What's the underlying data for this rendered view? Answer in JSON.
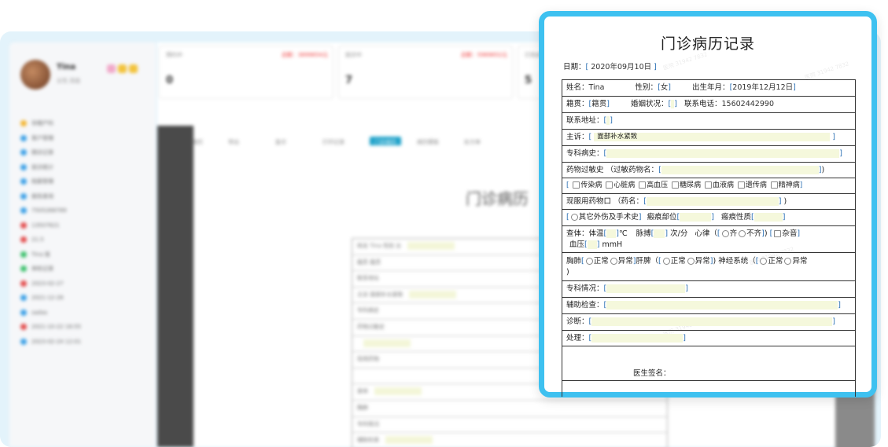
{
  "background": {
    "user": {
      "name": "Tina",
      "sub": "女性 高级"
    },
    "sidebar_items": [
      "孕期产科",
      "客户管理",
      "随访记录",
      "就诊统计",
      "档案管理",
      "报告查询",
      "7505268789",
      "13507621",
      "21.5",
      "Tina 医",
      "体检记录",
      "2023-02-27",
      "2021-12-26",
      "sadas",
      "2021-10-22 16:55",
      "2023-02-24 12:01"
    ],
    "cards": [
      {
        "title": "预约中",
        "alert": "总额：3899654元",
        "value": "0"
      },
      {
        "title": "就诊中",
        "alert": "总额：5969652元",
        "value": "7"
      },
      {
        "title": "已完成",
        "alert": "",
        "value": "5"
      }
    ],
    "toolbar": [
      "新增病历",
      "导出",
      "复诊",
      "打印记录",
      "门诊病历",
      "病历模板",
      "处方单"
    ],
    "doc_title": "门诊病历",
    "table_rows": [
      "姓名 Tina 性别 女",
      "籍贯 籍贯",
      "联系地址",
      "主诉 面部补水紧致",
      "专科病史",
      "药物过敏史",
      "",
      "现用药物",
      "",
      "查体",
      "胸肺",
      "专科情况",
      "辅助检查",
      "诊断"
    ]
  },
  "record": {
    "title": "门诊病历记录",
    "date_label": "日期：",
    "date_value": "2020年09月10日",
    "name_label": "姓名：",
    "name_value": "Tina",
    "gender_label": "性别：",
    "gender_value": "女",
    "birth_label": "出生年月：",
    "birth_value": "2019年12月12日",
    "native_label": "籍贯：",
    "native_value": "籍贯",
    "marital_label": "婚姻状况：",
    "phone_label": "联系电话：",
    "phone_value": "15602442990",
    "address_label": "联系地址：",
    "complaint_label": "主诉：",
    "complaint_value": "面部补水紧致",
    "history_label": "专科病史：",
    "allergy_label": "药物过敏史",
    "allergy_drug_label": "（过敏药物名：",
    "diseases": [
      "传染病",
      "心脏病",
      "高血压",
      "糖尿病",
      "血液病",
      "遗传病",
      "精神病"
    ],
    "meds_label": "现服用药物口",
    "meds_name_label": "（药名：",
    "trauma_label": "其它外伤及手术史",
    "scar_site_label": "瘢痕部位",
    "scar_nature_label": "瘢痕性质",
    "exam_label": "查体：体温",
    "temp_unit": "℃",
    "pulse_label": "脉搏",
    "pulse_unit": "次/分",
    "heart_label": "心律（",
    "heart_opts": [
      "齐",
      "不齐"
    ],
    "noise_label": "杂音",
    "bp_label": "血压",
    "bp_unit": "mmH",
    "chest_label": "胸肺",
    "normal": "正常",
    "abnormal": "异常",
    "liver_label": "肝脾（",
    "nerve_label": "神经系统（",
    "specialty_label": "专科情况：",
    "aux_label": "辅助检查：",
    "diagnosis_label": "诊断：",
    "treatment_label": "处理：",
    "signature_label": "医生签名："
  },
  "colors": {
    "accent": "#3ec1f0",
    "input_bg": "#f5f8dc",
    "bracket": "#2a6fb3"
  }
}
